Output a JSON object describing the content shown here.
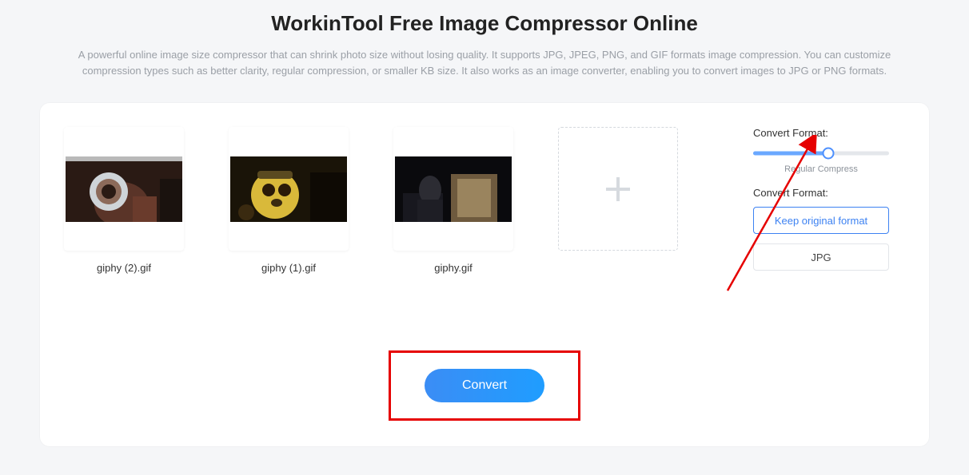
{
  "header": {
    "title": "WorkinTool Free Image Compressor Online",
    "description": "A powerful online image size compressor that can shrink photo size without losing quality. It supports JPG, JPEG, PNG, and GIF formats image compression. You can customize compression types such as better clarity, regular compression, or smaller KB size. It also works as an image converter, enabling you to convert images to JPG or PNG formats."
  },
  "files": [
    {
      "name": "giphy (2).gif"
    },
    {
      "name": "giphy (1).gif"
    },
    {
      "name": "giphy.gif"
    }
  ],
  "sidebar": {
    "compress_label": "Convert Format:",
    "slider_caption": "Regular Compress",
    "format_label": "Convert Format:",
    "format_options": {
      "keep": "Keep original format",
      "jpg": "JPG"
    }
  },
  "actions": {
    "convert": "Convert"
  }
}
